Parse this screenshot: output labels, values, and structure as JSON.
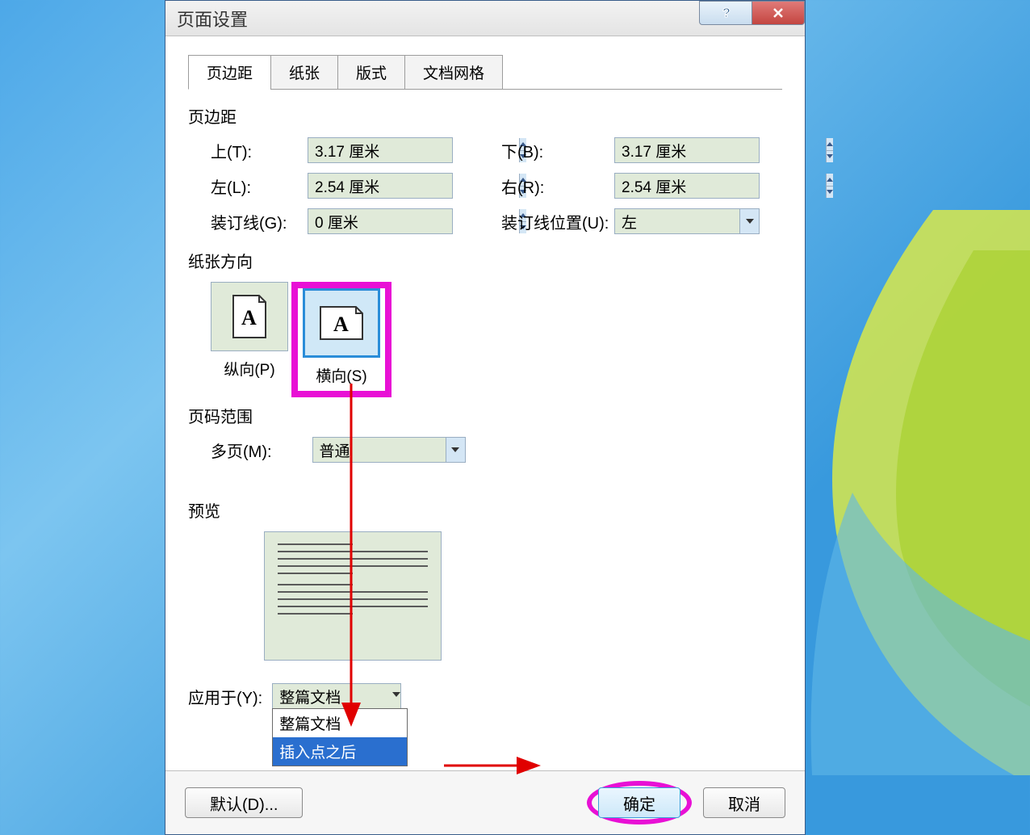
{
  "dialog": {
    "title": "页面设置"
  },
  "tabs": [
    "页边距",
    "纸张",
    "版式",
    "文档网格"
  ],
  "margins": {
    "section": "页边距",
    "top_label": "上(T):",
    "top_value": "3.17 厘米",
    "bottom_label": "下(B):",
    "bottom_value": "3.17 厘米",
    "left_label": "左(L):",
    "left_value": "2.54 厘米",
    "right_label": "右(R):",
    "right_value": "2.54 厘米",
    "gutter_label": "装订线(G):",
    "gutter_value": "0 厘米",
    "gutter_pos_label": "装订线位置(U):",
    "gutter_pos_value": "左"
  },
  "orientation": {
    "section": "纸张方向",
    "portrait": "纵向(P)",
    "landscape": "横向(S)"
  },
  "pages": {
    "section": "页码范围",
    "multi_label": "多页(M):",
    "multi_value": "普通"
  },
  "preview": {
    "section": "预览"
  },
  "apply": {
    "label": "应用于(Y):",
    "value": "整篇文档",
    "options": [
      "整篇文档",
      "插入点之后"
    ]
  },
  "buttons": {
    "default": "默认(D)...",
    "ok": "确定",
    "cancel": "取消"
  }
}
